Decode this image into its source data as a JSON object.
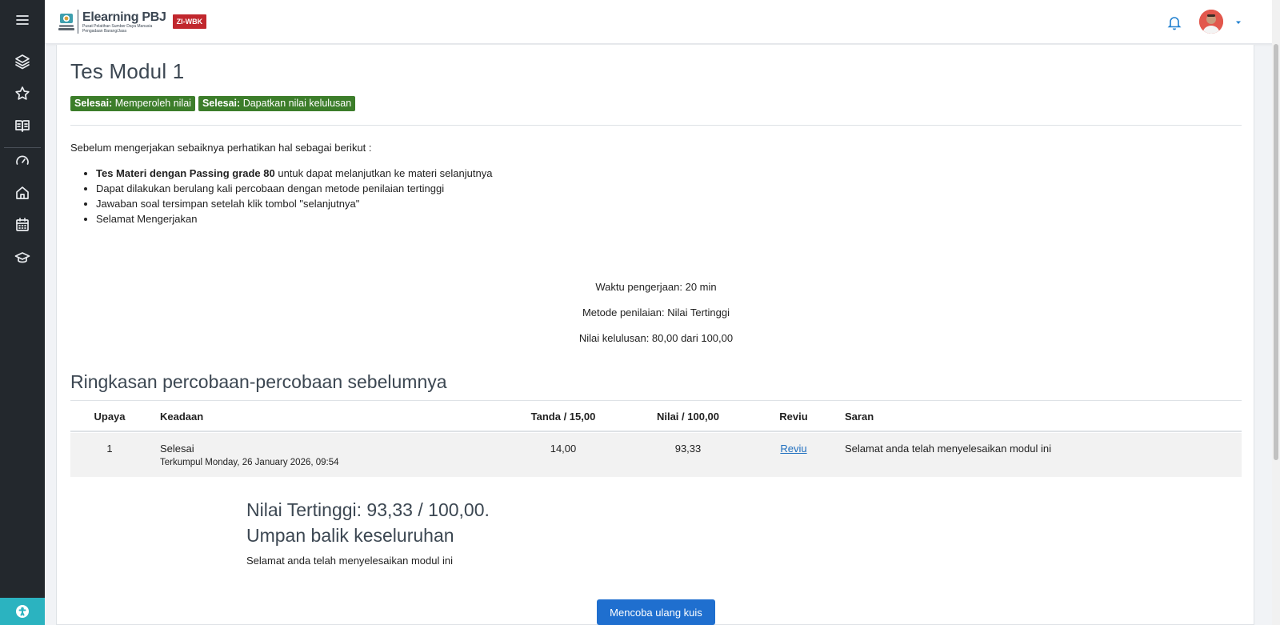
{
  "brand": {
    "name": "Elearning PBJ",
    "tagline": "Pusat Pelatihan Sumber Daya Manusia Pengadaan Barang/Jasa",
    "badge": "ZI-WBK",
    "badge_color": "#c1272d"
  },
  "sidebar": {
    "items": [
      {
        "icon": "menu-icon"
      },
      {
        "icon": "layers-icon"
      },
      {
        "icon": "star-icon"
      },
      {
        "icon": "book-icon"
      },
      {
        "icon": "dashboard-icon"
      },
      {
        "icon": "home-icon"
      },
      {
        "icon": "calendar-icon"
      },
      {
        "icon": "graduation-cap-icon"
      }
    ],
    "accessibility_icon": "accessibility-icon",
    "accent": "#2bb3c0"
  },
  "header": {
    "bell_icon": "bell-icon",
    "avatar_icon": "user-avatar"
  },
  "page": {
    "title": "Tes Modul 1",
    "completion": [
      {
        "label": "Selesai:",
        "text": "Memperoleh nilai"
      },
      {
        "label": "Selesai:",
        "text": "Dapatkan nilai kelulusan"
      }
    ],
    "intro": "Sebelum mengerjakan sebaiknya perhatikan hal sebagai berikut :",
    "bullets": [
      {
        "bold": "Tes Materi dengan Passing grade 80",
        "text": " untuk dapat melanjutkan ke materi selanjutnya"
      },
      {
        "bold": "",
        "text": "Dapat dilakukan berulang kali percobaan dengan metode penilaian tertinggi"
      },
      {
        "bold": "",
        "text": "Jawaban soal tersimpan setelah klik tombol \"selanjutnya\""
      },
      {
        "bold": "",
        "text": "Selamat Mengerjakan"
      }
    ],
    "info": [
      "Waktu pengerjaan: 20 min",
      "Metode penilaian: Nilai Tertinggi",
      "Nilai kelulusan: 80,00 dari 100,00"
    ]
  },
  "summary": {
    "heading": "Ringkasan percobaan-percobaan sebelumnya",
    "columns": {
      "attempt": "Upaya",
      "state": "Keadaan",
      "marks": "Tanda / 15,00",
      "grade": "Nilai / 100,00",
      "review": "Reviu",
      "feedback": "Saran"
    },
    "rows": [
      {
        "attempt": "1",
        "state": "Selesai",
        "submitted": "Terkumpul Monday, 26 January 2026, 09:54",
        "marks": "14,00",
        "grade": "93,33",
        "review": "Reviu",
        "feedback": "Selamat anda telah menyelesaikan modul ini"
      }
    ]
  },
  "result": {
    "highest": "Nilai Tertinggi: 93,33 / 100,00.",
    "feedback_heading": "Umpan balik keseluruhan",
    "feedback_text": "Selamat anda telah menyelesaikan modul ini",
    "retry_button": "Mencoba ulang kuis"
  },
  "colors": {
    "completion_badge": "#3c7d2a",
    "primary_button": "#1f6fcf",
    "sidebar_bg": "#23282d"
  }
}
